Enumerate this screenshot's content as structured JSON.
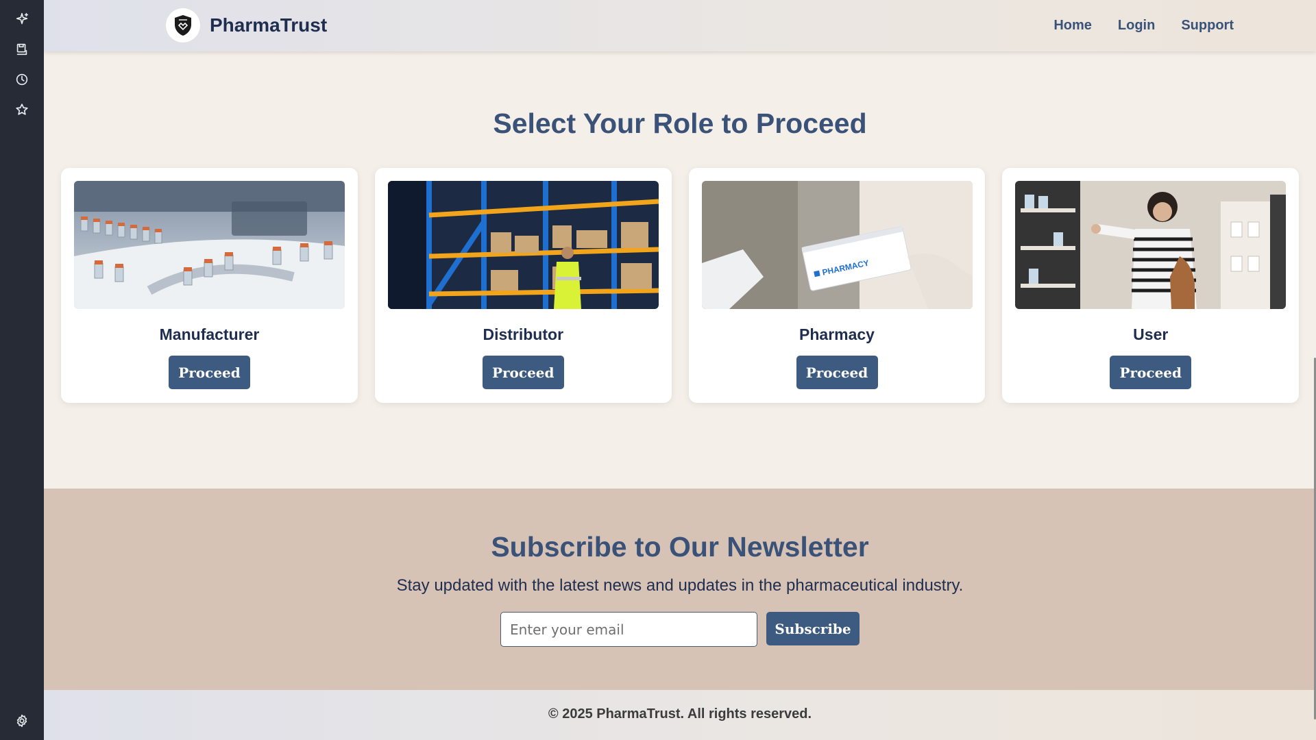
{
  "sidebar": {
    "icons": [
      "sparkle-icon",
      "save-icon",
      "history-icon",
      "star-icon",
      "gear-icon"
    ]
  },
  "nav": {
    "brand": "PharmaTrust",
    "links": [
      "Home",
      "Login",
      "Support"
    ]
  },
  "roles": {
    "title": "Select Your Role to Proceed",
    "cards": [
      {
        "label": "Manufacturer",
        "button": "Proceed",
        "image": "manufacturing-line-image"
      },
      {
        "label": "Distributor",
        "button": "Proceed",
        "image": "warehouse-worker-image"
      },
      {
        "label": "Pharmacy",
        "button": "Proceed",
        "image": "pharmacy-box-handoff-image",
        "image_text": "PHARMACY"
      },
      {
        "label": "User",
        "button": "Proceed",
        "image": "shopper-in-pharmacy-image"
      }
    ]
  },
  "newsletter": {
    "title": "Subscribe to Our Newsletter",
    "text": "Stay updated with the latest news and updates in the pharmaceutical industry.",
    "placeholder": "Enter your email",
    "button": "Subscribe"
  },
  "footer": {
    "text": "© 2025 PharmaTrust. All rights reserved."
  },
  "colors": {
    "accent": "#3d5a80",
    "heading": "#3a5278",
    "newsletter_bg": "#d7c3b5",
    "page_bg": "#f5efe9",
    "sidebar_bg": "#262b36"
  }
}
